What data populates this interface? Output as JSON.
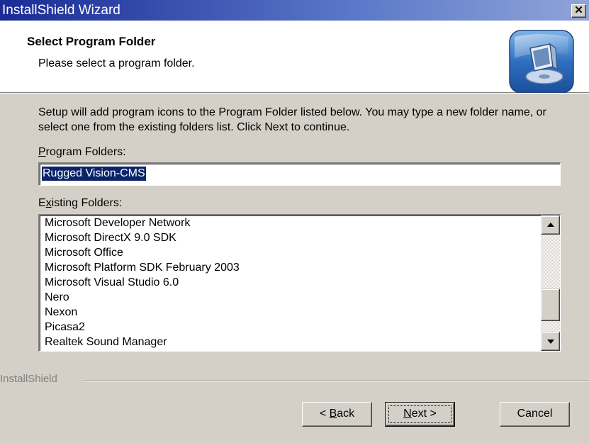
{
  "window": {
    "title": "InstallShield Wizard",
    "close_label": "✕"
  },
  "header": {
    "title": "Select Program Folder",
    "subtitle": "Please select a program folder.",
    "icon": "install-computer-icon"
  },
  "main": {
    "description": "Setup will add program icons to the Program Folder listed below.  You may type a new folder name, or select one from the existing folders list.  Click Next to continue.",
    "program_folders_label": {
      "prefix": "",
      "accel": "P",
      "rest": "rogram Folders:"
    },
    "program_folder_value": "Rugged Vision-CMS",
    "existing_folders_label": {
      "prefix": "E",
      "accel": "x",
      "rest": "isting Folders:"
    },
    "existing_folders": [
      "Microsoft Developer Network",
      "Microsoft DirectX 9.0 SDK",
      "Microsoft Office",
      "Microsoft Platform SDK February 2003",
      "Microsoft Visual Studio 6.0",
      "Nero",
      "Nexon",
      "Picasa2",
      "Realtek Sound Manager"
    ]
  },
  "footer": {
    "brand": "InstallShield",
    "back": {
      "prefix": "< ",
      "accel": "B",
      "rest": "ack"
    },
    "next": {
      "prefix": "",
      "accel": "N",
      "rest": "ext >"
    },
    "cancel": "Cancel"
  },
  "colors": {
    "title_bar_start": "#1a2b96",
    "title_bar_end": "#8fa4d8",
    "dialog_face": "#d4d0c8",
    "selection": "#0a246a"
  }
}
